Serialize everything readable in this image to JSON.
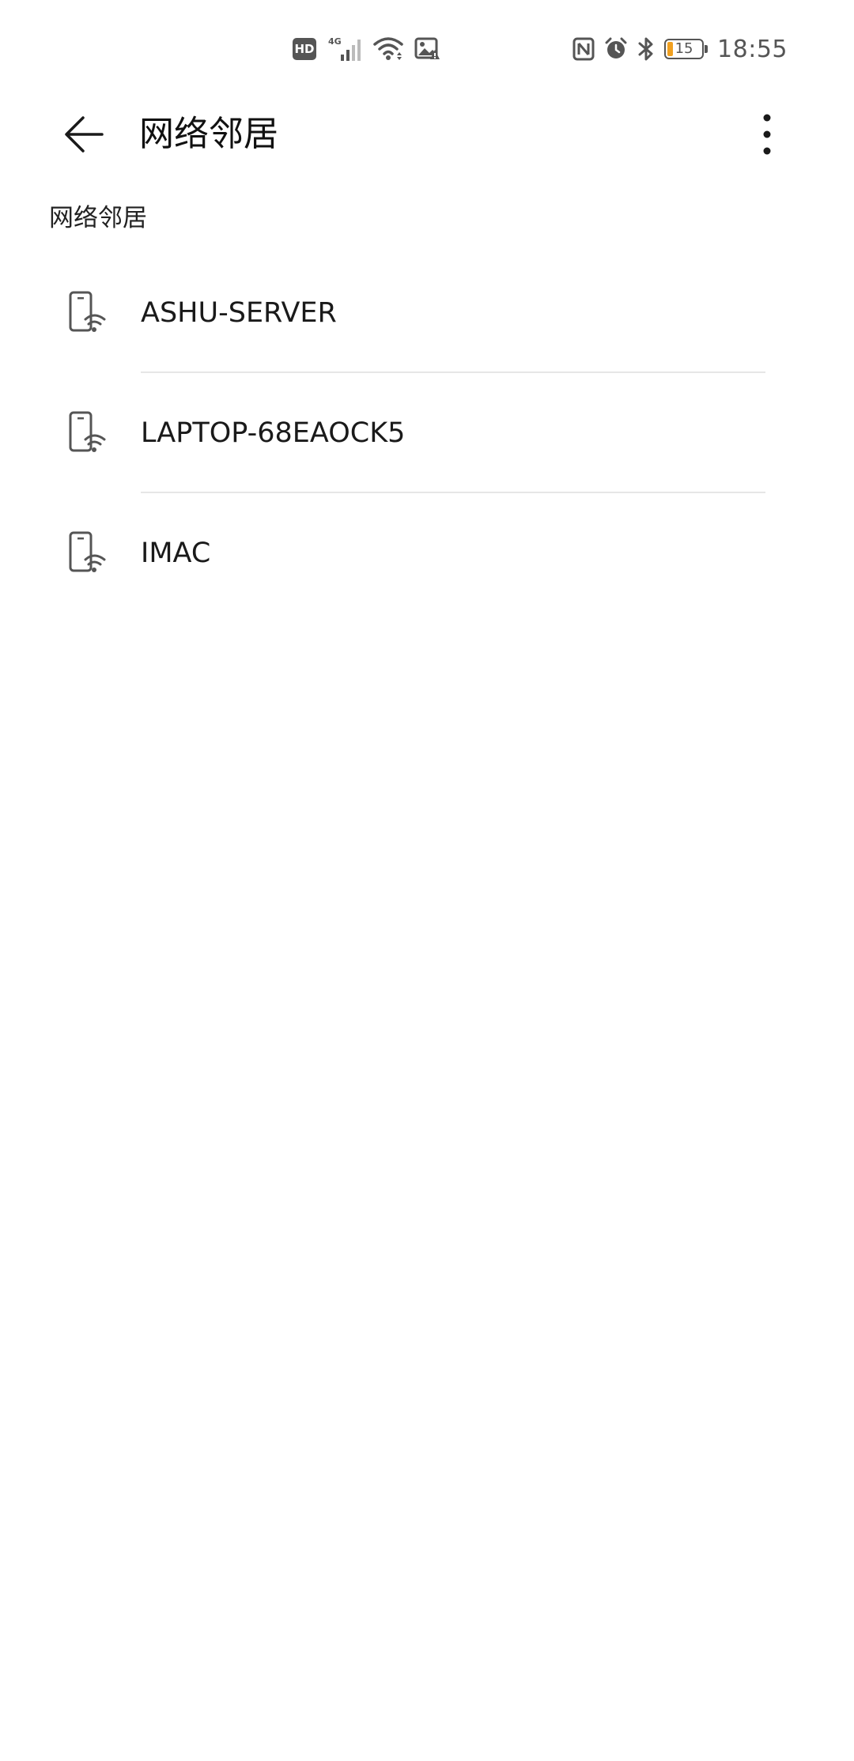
{
  "status_bar": {
    "hd": "HD",
    "network": "4G",
    "battery_level": "15",
    "battery_fraction": 0.15,
    "battery_color": "#f0a020",
    "time": "18:55",
    "icons": [
      "hd-icon",
      "signal-4g-icon",
      "wifi-icon",
      "image-warning-icon",
      "nfc-icon",
      "alarm-icon",
      "bluetooth-icon",
      "battery-icon"
    ]
  },
  "app_bar": {
    "title": "网络邻居",
    "back_icon": "arrow-left-icon",
    "more_icon": "more-vertical-icon"
  },
  "section": {
    "header": "网络邻居"
  },
  "devices": [
    {
      "name": "ASHU-SERVER",
      "icon": "network-device-icon"
    },
    {
      "name": "LAPTOP-68EAOCK5",
      "icon": "network-device-icon"
    },
    {
      "name": "IMAC",
      "icon": "network-device-icon"
    }
  ]
}
